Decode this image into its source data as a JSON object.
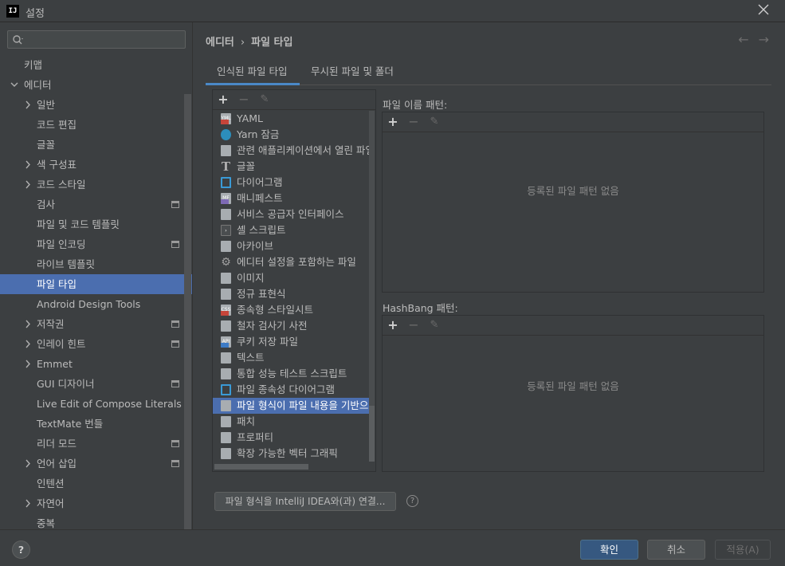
{
  "window": {
    "title": "설정",
    "app_icon": "IJ"
  },
  "sidebar": {
    "search_placeholder": "",
    "items": [
      {
        "label": "키맵",
        "level": 0,
        "chevron": "",
        "project": false
      },
      {
        "label": "에디터",
        "level": 0,
        "chevron": "down",
        "project": false
      },
      {
        "label": "일반",
        "level": 1,
        "chevron": "right",
        "project": false
      },
      {
        "label": "코드 편집",
        "level": 1,
        "chevron": "",
        "project": false
      },
      {
        "label": "글꼴",
        "level": 1,
        "chevron": "",
        "project": false
      },
      {
        "label": "색 구성표",
        "level": 1,
        "chevron": "right",
        "project": false
      },
      {
        "label": "코드 스타일",
        "level": 1,
        "chevron": "right",
        "project": false
      },
      {
        "label": "검사",
        "level": 1,
        "chevron": "",
        "project": true
      },
      {
        "label": "파일 및 코드 템플릿",
        "level": 1,
        "chevron": "",
        "project": false
      },
      {
        "label": "파일 인코딩",
        "level": 1,
        "chevron": "",
        "project": true
      },
      {
        "label": "라이브 템플릿",
        "level": 1,
        "chevron": "",
        "project": false
      },
      {
        "label": "파일 타입",
        "level": 1,
        "chevron": "",
        "project": false,
        "selected": true
      },
      {
        "label": "Android Design Tools",
        "level": 1,
        "chevron": "",
        "project": false
      },
      {
        "label": "저작권",
        "level": 1,
        "chevron": "right",
        "project": true
      },
      {
        "label": "인레이 힌트",
        "level": 1,
        "chevron": "right",
        "project": true
      },
      {
        "label": "Emmet",
        "level": 1,
        "chevron": "right",
        "project": false
      },
      {
        "label": "GUI 디자이너",
        "level": 1,
        "chevron": "",
        "project": true
      },
      {
        "label": "Live Edit of Compose Literals",
        "level": 1,
        "chevron": "",
        "project": false
      },
      {
        "label": "TextMate 번들",
        "level": 1,
        "chevron": "",
        "project": false
      },
      {
        "label": "리더 모드",
        "level": 1,
        "chevron": "",
        "project": true
      },
      {
        "label": "언어 삽입",
        "level": 1,
        "chevron": "right",
        "project": true
      },
      {
        "label": "인텐션",
        "level": 1,
        "chevron": "",
        "project": false
      },
      {
        "label": "자연어",
        "level": 1,
        "chevron": "right",
        "project": false
      },
      {
        "label": "중복",
        "level": 1,
        "chevron": "",
        "project": false
      }
    ]
  },
  "breadcrumb": {
    "parent": "에디터",
    "separator": "›",
    "current": "파일 타입"
  },
  "tabs": [
    {
      "label": "인식된 파일 타입",
      "active": true
    },
    {
      "label": "무시된 파일 및 폴더",
      "active": false
    }
  ],
  "toolbar": {
    "add": "+",
    "remove": "−",
    "edit": "✎"
  },
  "file_types": [
    {
      "label": "YAML",
      "icon": "yaml-file-icon",
      "style": "red",
      "glyph": "YML"
    },
    {
      "label": "Yarn 잠금",
      "icon": "yarn-icon",
      "style": "yarn",
      "glyph": ""
    },
    {
      "label": "관련 애플리케이션에서 열린 파일",
      "icon": "native-file-icon",
      "style": "",
      "glyph": ""
    },
    {
      "label": "글꼴",
      "icon": "font-icon",
      "style": "text",
      "glyph": "T"
    },
    {
      "label": "다이어그램",
      "icon": "diagram-icon",
      "style": "diag",
      "glyph": ""
    },
    {
      "label": "매니페스트",
      "icon": "manifest-icon",
      "style": "purple",
      "glyph": "MF"
    },
    {
      "label": "서비스 공급자 인터페이스",
      "icon": "spi-file-icon",
      "style": "",
      "glyph": ""
    },
    {
      "label": "셸 스크립트",
      "icon": "shell-script-icon",
      "style": "dark",
      "glyph": "›"
    },
    {
      "label": "아카이브",
      "icon": "archive-icon",
      "style": "",
      "glyph": ""
    },
    {
      "label": "에디터 설정을 포함하는 파일",
      "icon": "gear-icon",
      "style": "gear",
      "glyph": "⚙"
    },
    {
      "label": "이미지",
      "icon": "image-file-icon",
      "style": "",
      "glyph": ""
    },
    {
      "label": "정규 표현식",
      "icon": "regexp-icon",
      "style": "",
      "glyph": ""
    },
    {
      "label": "종속형 스타일시트",
      "icon": "css-file-icon",
      "style": "red",
      "glyph": "CSS"
    },
    {
      "label": "철자 검사기 사전",
      "icon": "dictionary-icon",
      "style": "",
      "glyph": ""
    },
    {
      "label": "쿠키 저장 파일",
      "icon": "cookie-file-icon",
      "style": "blue",
      "glyph": "API"
    },
    {
      "label": "텍스트",
      "icon": "text-file-icon",
      "style": "",
      "glyph": ""
    },
    {
      "label": "통합 성능 테스트 스크립트",
      "icon": "script-file-icon",
      "style": "",
      "glyph": ""
    },
    {
      "label": "파일 종속성 다이어그램",
      "icon": "dependency-diagram-icon",
      "style": "diag",
      "glyph": ""
    },
    {
      "label": "파일 형식이 파일 내용을 기반으로 함",
      "icon": "file-icon",
      "style": "",
      "glyph": "",
      "selected": true
    },
    {
      "label": "패치",
      "icon": "patch-file-icon",
      "style": "",
      "glyph": ""
    },
    {
      "label": "프로퍼티",
      "icon": "properties-file-icon",
      "style": "",
      "glyph": ""
    },
    {
      "label": "확장 가능한 벡터 그래픽",
      "icon": "svg-file-icon",
      "style": "",
      "glyph": ""
    }
  ],
  "file_name_patterns": {
    "label": "파일 이름 패턴:",
    "empty": "등록된 파일 패턴 없음"
  },
  "hashbang_patterns": {
    "label": "HashBang 패턴:",
    "empty": "등록된 파일 패턴 없음"
  },
  "associate_button": "파일 형식을 IntelliJ IDEA와(과) 연결...",
  "footer": {
    "help": "?",
    "ok": "확인",
    "cancel": "취소",
    "apply": "적용(A)"
  },
  "colors": {
    "selection": "#4b6eaf",
    "accent": "#4a88c7",
    "background": "#3c3f41"
  }
}
